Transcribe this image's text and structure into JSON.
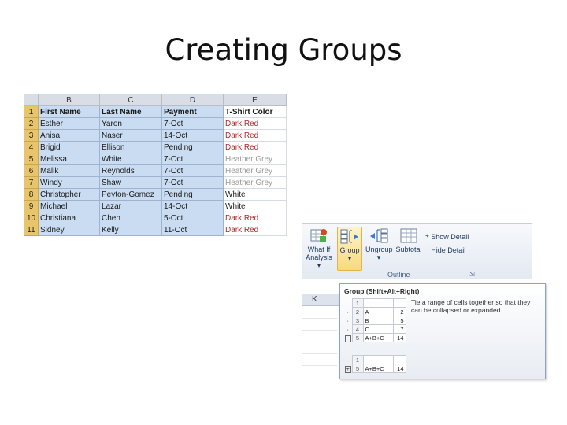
{
  "title": "Creating Groups",
  "sheet": {
    "columns": [
      "B",
      "C",
      "D",
      "E"
    ],
    "rows": [
      {
        "n": "1",
        "first": "First Name",
        "last": "Last Name",
        "pay": "Payment",
        "color": "T-Shirt Color"
      },
      {
        "n": "2",
        "first": "Esther",
        "last": "Yaron",
        "pay": "7-Oct",
        "color": "Dark Red"
      },
      {
        "n": "3",
        "first": "Anisa",
        "last": "Naser",
        "pay": "14-Oct",
        "color": "Dark Red"
      },
      {
        "n": "4",
        "first": "Brigid",
        "last": "Ellison",
        "pay": "Pending",
        "color": "Dark Red"
      },
      {
        "n": "5",
        "first": "Melissa",
        "last": "White",
        "pay": "7-Oct",
        "color": "Heather Grey"
      },
      {
        "n": "6",
        "first": "Malik",
        "last": "Reynolds",
        "pay": "7-Oct",
        "color": "Heather Grey"
      },
      {
        "n": "7",
        "first": "Windy",
        "last": "Shaw",
        "pay": "7-Oct",
        "color": "Heather Grey"
      },
      {
        "n": "8",
        "first": "Christopher",
        "last": "Peyton-Gomez",
        "pay": "Pending",
        "color": "White"
      },
      {
        "n": "9",
        "first": "Michael",
        "last": "Lazar",
        "pay": "14-Oct",
        "color": "White"
      },
      {
        "n": "10",
        "first": "Christiana",
        "last": "Chen",
        "pay": "5-Oct",
        "color": "Dark Red"
      },
      {
        "n": "11",
        "first": "Sidney",
        "last": "Kelly",
        "pay": "11-Oct",
        "color": "Dark Red"
      }
    ],
    "color_map": {
      "Dark Red": "#b4282e",
      "Heather Grey": "#9a9a9a",
      "White": "#222222"
    }
  },
  "ribbon": {
    "whatif_line1": "What If",
    "whatif_line2": "Analysis ▾",
    "group": "Group",
    "ungroup": "Ungroup",
    "subtotal": "Subtotal",
    "show_detail": "Show Detail",
    "hide_detail": "Hide Detail",
    "outline": "Outline",
    "launcher": "⇲"
  },
  "grid": {
    "column_k": "K"
  },
  "tooltip": {
    "title": "Group (Shift+Alt+Right)",
    "description": "Tie a range of cells together so that they can be collapsed or expanded.",
    "expanded": [
      {
        "n": "1",
        "name": "",
        "val": ""
      },
      {
        "n": "2",
        "name": "A",
        "val": "2"
      },
      {
        "n": "3",
        "name": "B",
        "val": "5"
      },
      {
        "n": "4",
        "name": "C",
        "val": "7"
      },
      {
        "n": "5",
        "name": "A+B+C",
        "val": "14"
      }
    ],
    "collapsed": [
      {
        "n": "1",
        "name": "",
        "val": ""
      },
      {
        "n": "5",
        "name": "A+B+C",
        "val": "14"
      }
    ],
    "minus": "−",
    "plus": "+"
  },
  "colors": {
    "selection": "#c9dcf2",
    "row_header_selected": "#e8c56a",
    "ribbon_accent": "#1e395b"
  }
}
